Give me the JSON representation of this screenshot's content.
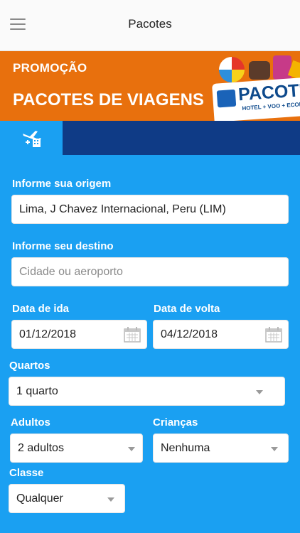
{
  "header": {
    "title": "Pacotes"
  },
  "banner": {
    "promo_label": "PROMOÇÃO",
    "title": "PACOTES DE VIAGENS",
    "logo_text": "PACOTES",
    "logo_sub": "HOTEL + VOO + ECONO"
  },
  "tabs": [
    {
      "icon": "flight-hotel-icon",
      "active": true
    }
  ],
  "form": {
    "origin": {
      "label": "Informe sua origem",
      "value": "Lima, J Chavez Internacional, Peru (LIM)"
    },
    "destination": {
      "label": "Informe seu destino",
      "placeholder": "Cidade ou aeroporto"
    },
    "departure": {
      "label": "Data de ida",
      "value": "01/12/2018"
    },
    "return": {
      "label": "Data de volta",
      "value": "04/12/2018"
    },
    "rooms": {
      "label": "Quartos",
      "value": "1 quarto"
    },
    "adults": {
      "label": "Adultos",
      "value": "2 adultos"
    },
    "children": {
      "label": "Crianças",
      "value": "Nenhuma"
    },
    "class": {
      "label": "Classe",
      "value": "Qualquer"
    }
  },
  "colors": {
    "banner": "#e8700d",
    "tabbar": "#0f3b86",
    "form_bg": "#1aa0f2"
  }
}
